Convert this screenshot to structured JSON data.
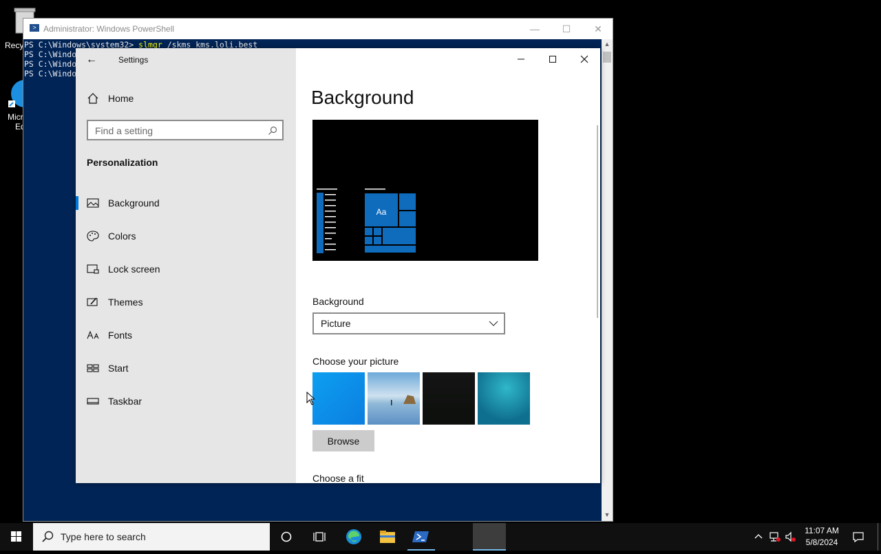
{
  "desktop": {
    "recycle_label": "Recy",
    "edge_label_1": "Micr",
    "edge_label_2": "Ed"
  },
  "powershell": {
    "title": "Administrator: Windows PowerShell",
    "lines": [
      {
        "prompt": "PS C:\\Windows\\system32> ",
        "cmd": "slmgr",
        "rest": " /skms kms.loli.best"
      },
      {
        "prompt": "PS C:\\Windo",
        "cmd": "",
        "rest": ""
      },
      {
        "prompt": "PS C:\\Windo",
        "cmd": "",
        "rest": ""
      },
      {
        "prompt": "PS C:\\Windo",
        "cmd": "",
        "rest": ""
      }
    ]
  },
  "settings": {
    "title": "Settings",
    "home_label": "Home",
    "search_placeholder": "Find a setting",
    "section": "Personalization",
    "nav": [
      {
        "label": "Background",
        "icon": "picture-icon",
        "selected": true
      },
      {
        "label": "Colors",
        "icon": "palette-icon",
        "selected": false
      },
      {
        "label": "Lock screen",
        "icon": "lock-screen-icon",
        "selected": false
      },
      {
        "label": "Themes",
        "icon": "themes-icon",
        "selected": false
      },
      {
        "label": "Fonts",
        "icon": "fonts-icon",
        "selected": false
      },
      {
        "label": "Start",
        "icon": "start-icon",
        "selected": false
      },
      {
        "label": "Taskbar",
        "icon": "taskbar-icon",
        "selected": false
      }
    ],
    "page_title": "Background",
    "preview_tile_text": "Aa",
    "background_label": "Background",
    "background_value": "Picture",
    "choose_picture_label": "Choose your picture",
    "browse_label": "Browse",
    "choose_fit_label": "Choose a fit"
  },
  "taskbar": {
    "search_placeholder": "Type here to search",
    "time": "11:07 AM",
    "date": "5/8/2024"
  },
  "colors": {
    "accent": "#0078d7",
    "ps_bg": "#012456"
  }
}
